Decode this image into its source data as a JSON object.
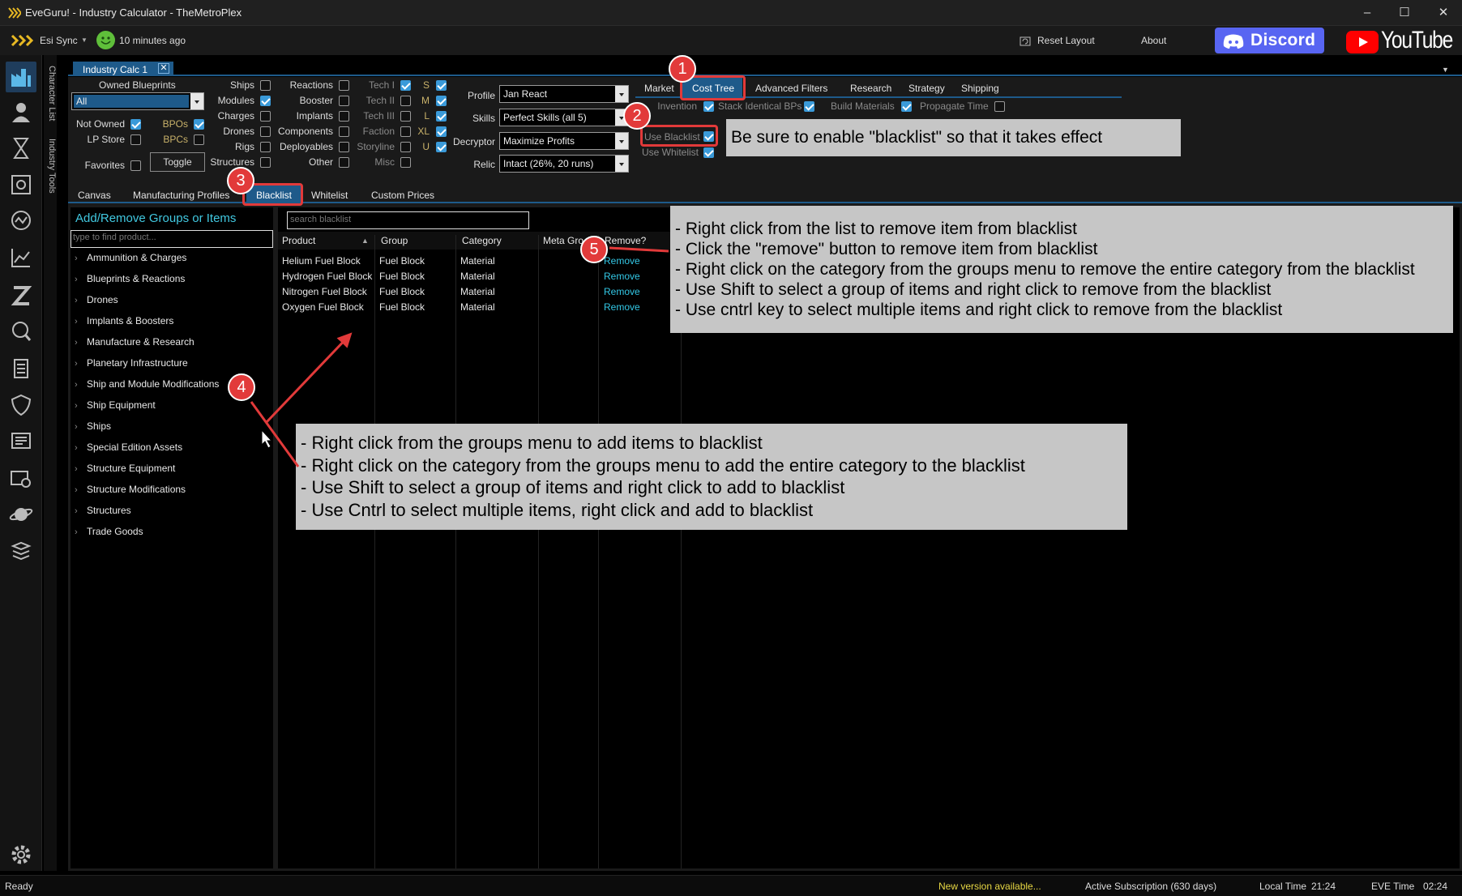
{
  "window": {
    "title": "EveGuru! - Industry Calculator - TheMetroPlex",
    "minimize": "–",
    "maximize": "☐",
    "close": "✕"
  },
  "toolbar": {
    "esi_label": "Esi Sync",
    "sync_age": "10 minutes ago",
    "reset_layout": "Reset Layout",
    "about": "About",
    "discord": "Discord",
    "youtube": "YouTube"
  },
  "sidebar": {
    "vertical_tabs": [
      "Character List",
      "Industry Tools"
    ],
    "icons": [
      "factory-icon",
      "character-icon",
      "hourglass-icon",
      "blueprint-icon",
      "market-icon",
      "chart-icon",
      "z-icon",
      "search-icon",
      "scroll-icon",
      "shield-icon",
      "report-icon",
      "tools-icon",
      "planet-icon",
      "stack-icon",
      "settings-icon"
    ]
  },
  "document_tab": {
    "label": "Industry Calc 1",
    "close": "✕"
  },
  "filters": {
    "owned_blueprints_label": "Owned Blueprints",
    "owned_blueprints_value": "All",
    "not_owned": "Not Owned",
    "bpos": "BPOs",
    "lp_store": "LP Store",
    "bpcs": "BPCs",
    "favorites": "Favorites",
    "toggle": "Toggle",
    "col_a": [
      "Ships",
      "Modules",
      "Charges",
      "Drones",
      "Rigs",
      "Structures"
    ],
    "col_b": [
      "Reactions",
      "Booster",
      "Implants",
      "Components",
      "Deployables",
      "Other"
    ],
    "col_c": [
      "Tech I",
      "Tech II",
      "Tech III",
      "Faction",
      "Storyline",
      "Misc"
    ],
    "col_d": [
      "S",
      "M",
      "L",
      "XL",
      "U"
    ],
    "profile_label": "Profile",
    "profile_value": "Jan React",
    "skills_label": "Skills",
    "skills_value": "Perfect Skills (all 5)",
    "decryptor_label": "Decryptor",
    "decryptor_value": "Maximize Profits",
    "relic_label": "Relic",
    "relic_value": "Intact (26%, 20 runs)"
  },
  "cost_tabs": [
    "Market",
    "Cost Tree",
    "Advanced Filters",
    "Research",
    "Strategy",
    "Shipping"
  ],
  "cost_options": {
    "invention": "Invention",
    "stack_identical": "Stack Identical BPs",
    "build_materials": "Build Materials",
    "propagate_time": "Propagate Time",
    "use_blacklist": "Use Blacklist",
    "use_whitelist": "Use Whitelist"
  },
  "inner_tabs": [
    "Canvas",
    "Manufacturing Profiles",
    "Blacklist",
    "Whitelist",
    "Custom Prices"
  ],
  "tree": {
    "title": "Add/Remove Groups or Items",
    "search_placeholder": "type to find product...",
    "items": [
      "Ammunition & Charges",
      "Blueprints & Reactions",
      "Drones",
      "Implants & Boosters",
      "Manufacture & Research",
      "Planetary Infrastructure",
      "Ship and Module Modifications",
      "Ship Equipment",
      "Ships",
      "Special Edition Assets",
      "Structure Equipment",
      "Structure Modifications",
      "Structures",
      "Trade Goods"
    ]
  },
  "blacklist": {
    "search_placeholder": "search blacklist",
    "columns": [
      "Product",
      "Group",
      "Category",
      "Meta Gro",
      "Remove?"
    ],
    "rows": [
      {
        "product": "Helium Fuel Block",
        "group": "Fuel Block",
        "category": "Material",
        "action": "Remove"
      },
      {
        "product": "Hydrogen Fuel Block",
        "group": "Fuel Block",
        "category": "Material",
        "action": "Remove"
      },
      {
        "product": "Nitrogen Fuel Block",
        "group": "Fuel Block",
        "category": "Material",
        "action": "Remove"
      },
      {
        "product": "Oxygen Fuel Block",
        "group": "Fuel Block",
        "category": "Material",
        "action": "Remove"
      }
    ]
  },
  "status": {
    "ready": "Ready",
    "new_version": "New version available...",
    "subscription": "Active Subscription (630 days)",
    "local_time_label": "Local Time",
    "local_time": "21:24",
    "eve_time_label": "EVE Time",
    "eve_time": "02:24"
  },
  "annotations": {
    "badges": [
      "1",
      "2",
      "3",
      "4",
      "5"
    ],
    "note_blacklist": "Be sure to enable \"blacklist\" so that it takes effect",
    "note_remove": [
      "- Right click from the list to remove item from blacklist",
      "- Click the \"remove\" button to remove item from blacklist",
      "- Right click on the category from the groups menu to remove the entire category from the blacklist",
      "- Use Shift to select a group of items and right click to remove from the blacklist",
      "- Use cntrl key to select multiple items and right click to remove from the blacklist"
    ],
    "note_add": [
      "- Right click from the groups menu to add items to blacklist",
      "- Right click on the category from the groups menu to add the entire category to the blacklist",
      "- Use Shift to select a group of items and right click to add to blacklist",
      "- Use Cntrl to select multiple items, right click and add to blacklist"
    ],
    "annotation_color": "#e23a3a"
  },
  "colors": {
    "accent": "#1e5a8a",
    "link": "#33c8e6",
    "check": "#3a9ad9"
  }
}
